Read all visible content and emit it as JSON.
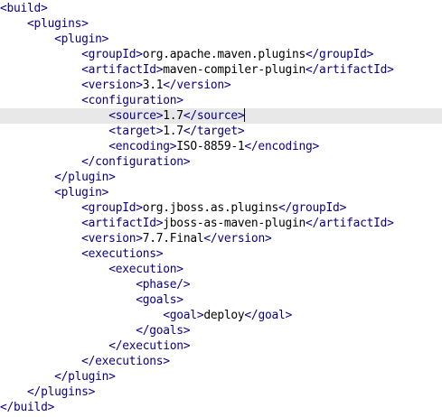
{
  "editor": {
    "indent_unit": "    ",
    "current_line": 7,
    "caret_after_line": 7,
    "lines": [
      {
        "indent": 0,
        "parts": [
          {
            "t": "tag",
            "v": "<build>"
          }
        ]
      },
      {
        "indent": 1,
        "parts": [
          {
            "t": "tag",
            "v": "<plugins>"
          }
        ]
      },
      {
        "indent": 2,
        "parts": [
          {
            "t": "tag",
            "v": "<plugin>"
          }
        ]
      },
      {
        "indent": 3,
        "parts": [
          {
            "t": "tag",
            "v": "<groupId>"
          },
          {
            "t": "txt",
            "v": "org.apache.maven.plugins"
          },
          {
            "t": "tag",
            "v": "</groupId>"
          }
        ]
      },
      {
        "indent": 3,
        "parts": [
          {
            "t": "tag",
            "v": "<artifactId>"
          },
          {
            "t": "txt",
            "v": "maven-compiler-plugin"
          },
          {
            "t": "tag",
            "v": "</artifactId>"
          }
        ]
      },
      {
        "indent": 3,
        "parts": [
          {
            "t": "tag",
            "v": "<version>"
          },
          {
            "t": "txt",
            "v": "3.1"
          },
          {
            "t": "tag",
            "v": "</version>"
          }
        ]
      },
      {
        "indent": 3,
        "parts": [
          {
            "t": "tag",
            "v": "<configuration>"
          }
        ]
      },
      {
        "indent": 4,
        "parts": [
          {
            "t": "tag",
            "v": "<source>"
          },
          {
            "t": "txt",
            "v": "1.7"
          },
          {
            "t": "tag",
            "v": "</source>"
          }
        ]
      },
      {
        "indent": 4,
        "parts": [
          {
            "t": "tag",
            "v": "<target>"
          },
          {
            "t": "txt",
            "v": "1.7"
          },
          {
            "t": "tag",
            "v": "</target>"
          }
        ]
      },
      {
        "indent": 4,
        "parts": [
          {
            "t": "tag",
            "v": "<encoding>"
          },
          {
            "t": "txt",
            "v": "ISO-8859-1"
          },
          {
            "t": "tag",
            "v": "</encoding>"
          }
        ]
      },
      {
        "indent": 3,
        "parts": [
          {
            "t": "tag",
            "v": "</configuration>"
          }
        ]
      },
      {
        "indent": 2,
        "parts": [
          {
            "t": "tag",
            "v": "</plugin>"
          }
        ]
      },
      {
        "indent": 2,
        "parts": [
          {
            "t": "tag",
            "v": "<plugin>"
          }
        ]
      },
      {
        "indent": 3,
        "parts": [
          {
            "t": "tag",
            "v": "<groupId>"
          },
          {
            "t": "txt",
            "v": "org.jboss.as.plugins"
          },
          {
            "t": "tag",
            "v": "</groupId>"
          }
        ]
      },
      {
        "indent": 3,
        "parts": [
          {
            "t": "tag",
            "v": "<artifactId>"
          },
          {
            "t": "txt",
            "v": "jboss-as-maven-plugin"
          },
          {
            "t": "tag",
            "v": "</artifactId>"
          }
        ]
      },
      {
        "indent": 3,
        "parts": [
          {
            "t": "tag",
            "v": "<version>"
          },
          {
            "t": "txt",
            "v": "7.7.Final"
          },
          {
            "t": "tag",
            "v": "</version>"
          }
        ]
      },
      {
        "indent": 3,
        "parts": [
          {
            "t": "tag",
            "v": "<executions>"
          }
        ]
      },
      {
        "indent": 4,
        "parts": [
          {
            "t": "tag",
            "v": "<execution>"
          }
        ]
      },
      {
        "indent": 5,
        "parts": [
          {
            "t": "tag",
            "v": "<phase/>"
          }
        ]
      },
      {
        "indent": 5,
        "parts": [
          {
            "t": "tag",
            "v": "<goals>"
          }
        ]
      },
      {
        "indent": 6,
        "parts": [
          {
            "t": "tag",
            "v": "<goal>"
          },
          {
            "t": "txt",
            "v": "deploy"
          },
          {
            "t": "tag",
            "v": "</goal>"
          }
        ]
      },
      {
        "indent": 5,
        "parts": [
          {
            "t": "tag",
            "v": "</goals>"
          }
        ]
      },
      {
        "indent": 4,
        "parts": [
          {
            "t": "tag",
            "v": "</execution>"
          }
        ]
      },
      {
        "indent": 3,
        "parts": [
          {
            "t": "tag",
            "v": "</executions>"
          }
        ]
      },
      {
        "indent": 2,
        "parts": [
          {
            "t": "tag",
            "v": "</plugin>"
          }
        ]
      },
      {
        "indent": 1,
        "parts": [
          {
            "t": "tag",
            "v": "</plugins>"
          }
        ]
      },
      {
        "indent": 0,
        "parts": [
          {
            "t": "tag",
            "v": "</build>"
          }
        ]
      }
    ]
  }
}
